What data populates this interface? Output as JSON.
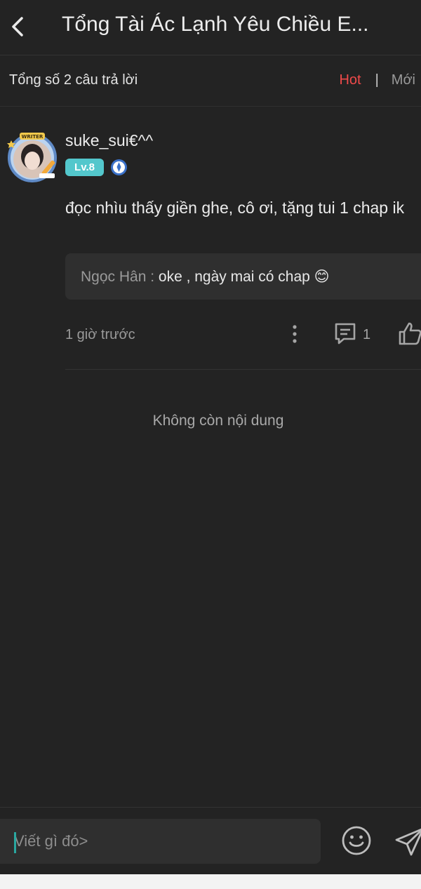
{
  "header": {
    "title": "Tổng Tài Ác Lạnh Yêu Chiều E...",
    "back_icon": "chevron-left-icon"
  },
  "summary": {
    "count_text": "Tổng số 2 câu trả lời",
    "sort_hot": "Hot",
    "sort_separator": "|",
    "sort_new": "Mới",
    "hot_color": "#ef4a4a"
  },
  "comment": {
    "username": "suke_sui€^^",
    "level": "Lv.8",
    "avatar_badge": "WRITER",
    "text": "đọc nhìu thấy giền ghe, cô ơi, tặng tui 1 chap ik",
    "reply": {
      "author": "Ngọc Hân : ",
      "body": "oke , ngày mai có chap 😊"
    },
    "time": "1 giờ trước",
    "reply_count": "1"
  },
  "footer_note": "Không còn nội dung",
  "composer": {
    "placeholder": "Viết gì đó>"
  }
}
